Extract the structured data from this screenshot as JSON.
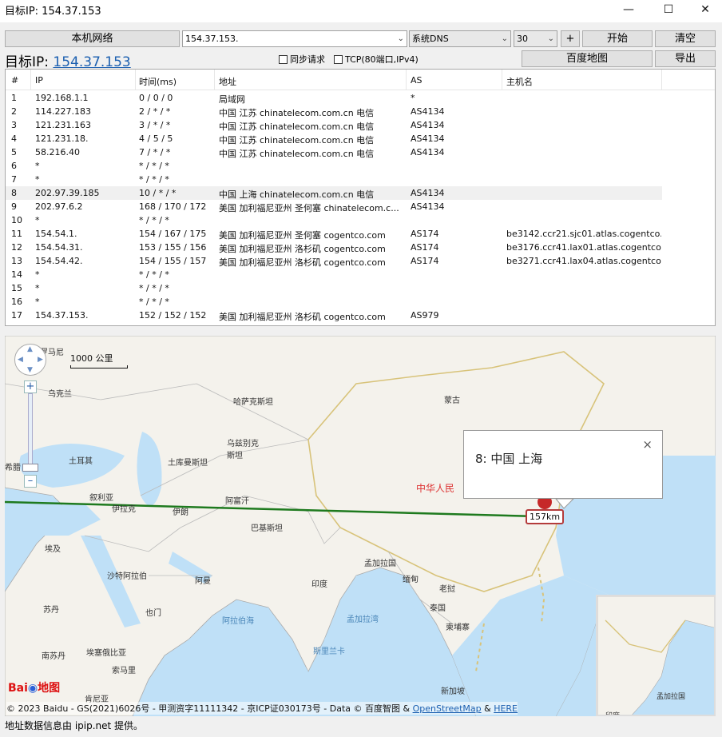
{
  "window": {
    "title": "目标IP: 154.37.153",
    "min_icon": "minimize-icon",
    "max_icon": "maximize-icon",
    "close_icon": "close-icon"
  },
  "toolbar": {
    "local_net_label": "本机网络",
    "target_input_value": "154.37.153.",
    "dns_select": "系统DNS",
    "count_select": "30",
    "plus_label": "+",
    "start_label": "开始",
    "clear_label": "清空",
    "map_label": "百度地图",
    "export_label": "导出",
    "sync_label": "同步请求",
    "tcp_label": "TCP(80端口,IPv4)"
  },
  "target": {
    "prefix": "目标IP: ",
    "ip": "154.37.153"
  },
  "table": {
    "headers": [
      "#",
      "IP",
      "时间(ms)",
      "地址",
      "AS",
      "主机名"
    ],
    "rows": [
      {
        "n": "1",
        "ip": "192.168.1.1",
        "time": "0 / 0 / 0",
        "addr": "局域网",
        "as": "*",
        "host": ""
      },
      {
        "n": "2",
        "ip": "114.227.183",
        "time": "2 / * / *",
        "addr": "中国 江苏       chinatelecom.com.cn 电信",
        "as": "AS4134",
        "host": ""
      },
      {
        "n": "3",
        "ip": "121.231.163",
        "time": "3 / * / *",
        "addr": "中国 江苏       chinatelecom.com.cn 电信",
        "as": "AS4134",
        "host": ""
      },
      {
        "n": "4",
        "ip": "121.231.18.",
        "time": "4 / 5 / 5",
        "addr": "中国 江苏       chinatelecom.com.cn 电信",
        "as": "AS4134",
        "host": ""
      },
      {
        "n": "5",
        "ip": "58.216.40",
        "time": "7 / * / *",
        "addr": "中国 江苏       chinatelecom.com.cn 电信",
        "as": "AS4134",
        "host": ""
      },
      {
        "n": "6",
        "ip": "*",
        "time": "* / * / *",
        "addr": "",
        "as": "",
        "host": ""
      },
      {
        "n": "7",
        "ip": "*",
        "time": "* / * / *",
        "addr": "",
        "as": "",
        "host": ""
      },
      {
        "n": "8",
        "ip": "202.97.39.185",
        "time": "10 / * / *",
        "addr": "中国 上海 chinatelecom.com.cn 电信",
        "as": "AS4134",
        "host": ""
      },
      {
        "n": "9",
        "ip": "202.97.6.2",
        "time": "168 / 170 / 172",
        "addr": "美国 加利福尼亚州 圣何塞 chinatelecom.c...",
        "as": "AS4134",
        "host": ""
      },
      {
        "n": "10",
        "ip": "*",
        "time": "* / * / *",
        "addr": "",
        "as": "",
        "host": ""
      },
      {
        "n": "11",
        "ip": "154.54.1.",
        "time": "154 / 167 / 175",
        "addr": "美国 加利福尼亚州 圣何塞 cogentco.com",
        "as": "AS174",
        "host": "be3142.ccr21.sjc01.atlas.cogentco...."
      },
      {
        "n": "12",
        "ip": "154.54.31.",
        "time": "153 / 155 / 156",
        "addr": "美国 加利福尼亚州 洛杉矶 cogentco.com",
        "as": "AS174",
        "host": "be3176.ccr41.lax01.atlas.cogentco...."
      },
      {
        "n": "13",
        "ip": "154.54.42.",
        "time": "154 / 155 / 157",
        "addr": "美国 加利福尼亚州 洛杉矶 cogentco.com",
        "as": "AS174",
        "host": "be3271.ccr41.lax04.atlas.cogentco...."
      },
      {
        "n": "14",
        "ip": "*",
        "time": "* / * / *",
        "addr": "",
        "as": "",
        "host": ""
      },
      {
        "n": "15",
        "ip": "*",
        "time": "* / * / *",
        "addr": "",
        "as": "",
        "host": ""
      },
      {
        "n": "16",
        "ip": "*",
        "time": "* / * / *",
        "addr": "",
        "as": "",
        "host": ""
      },
      {
        "n": "17",
        "ip": "154.37.153.",
        "time": "152 / 152 / 152",
        "addr": "美国 加利福尼亚州 洛杉矶 cogentco.com",
        "as": "AS979",
        "host": ""
      }
    ]
  },
  "map": {
    "scale_label": "1000 公里",
    "popup_text": "8: 中国 上海",
    "popup_close": "×",
    "distance_label": "157km",
    "labels": {
      "romania": "罗马尼",
      "ukraine": "乌克兰",
      "kazakhstan": "哈萨克斯坦",
      "mongolia": "蒙古",
      "uzbekistan": "乌兹别克\n斯坦",
      "turkey": "土耳其",
      "turkmenistan": "土库曼斯坦",
      "china": "中华人民",
      "greece": "希腊",
      "syria": "叙利亚",
      "iraq": "伊拉克",
      "iran": "伊朗",
      "afghanistan": "阿富汗",
      "pakistan": "巴基斯坦",
      "egypt": "埃及",
      "saudi": "沙特阿拉伯",
      "oman": "阿曼",
      "india": "印度",
      "bangladesh": "孟加拉国",
      "myanmar": "缅甸",
      "laos": "老挝",
      "thailand": "泰国",
      "cambodia": "柬埔寨",
      "sudan": "苏丹",
      "yemen": "也门",
      "arabian_sea": "阿拉伯海",
      "bay_of_bengal": "孟加拉湾",
      "sri_lanka": "斯里兰卡",
      "south_sudan": "南苏丹",
      "ethiopia": "埃塞俄比亚",
      "somalia": "索马里",
      "kenya": "肯尼亚",
      "malaysia": "新加坡",
      "overview_bangladesh": "孟加拉国",
      "overview_india": "印度"
    },
    "copyright_prefix": "© 2023 Baidu - GS(2021)6026号 - 甲测资字11111342 - 京ICP证030173号 - Data © 百度智图 & ",
    "osm_link": "OpenStreetMap",
    "amp": " & ",
    "here_link": "HERE",
    "baidu_logo": "Bai",
    "baidu_logo2": "地图",
    "route_color": "#1e7a1e",
    "marker_color": "#c62828"
  },
  "status": {
    "text": "地址数据信息由 ipip.net 提供。"
  }
}
